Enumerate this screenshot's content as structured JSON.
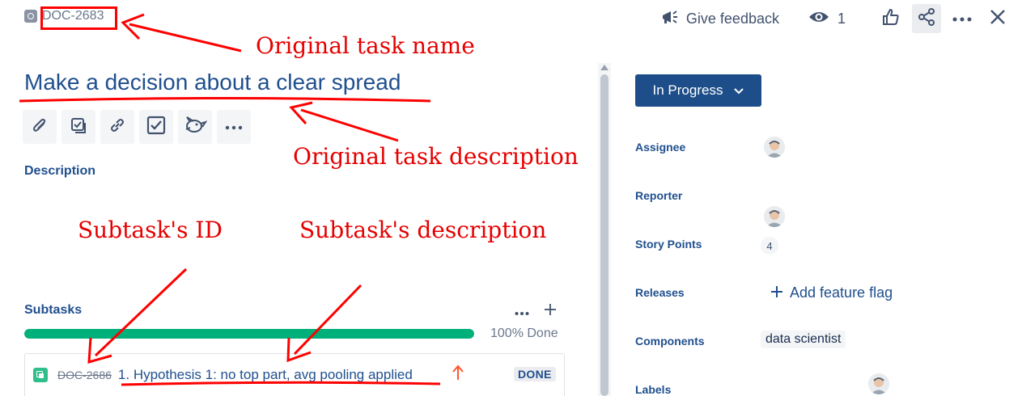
{
  "issue": {
    "key": "DOC-2683",
    "title": "Make a decision about a clear spread",
    "status": "In Progress"
  },
  "header": {
    "feedback_label": "Give feedback",
    "watch_count": "1"
  },
  "description": {
    "heading": "Description"
  },
  "subtasks": {
    "heading": "Subtasks",
    "progress": 1.0,
    "progress_label": "100% Done",
    "items": [
      {
        "key": "DOC-2686",
        "summary": "1. Hypothesis 1: no top part, avg pooling applied",
        "status": "DONE"
      }
    ]
  },
  "fields": {
    "assignee_label": "Assignee",
    "reporter_label": "Reporter",
    "story_points_label": "Story Points",
    "story_points_value": "4",
    "releases_label": "Releases",
    "add_feature_flag": "Add feature flag",
    "components_label": "Components",
    "component_value": "data scientist",
    "labels_label": "Labels"
  },
  "annotations": {
    "original_task_name": "Original  task  name",
    "original_task_description": "Original  task  description",
    "subtask_id": "Subtask's  ID",
    "subtask_description": "Subtask's  description"
  },
  "colors": {
    "annotation": "#e60000",
    "status_button": "#1D4E89",
    "progress": "#00B07A"
  }
}
